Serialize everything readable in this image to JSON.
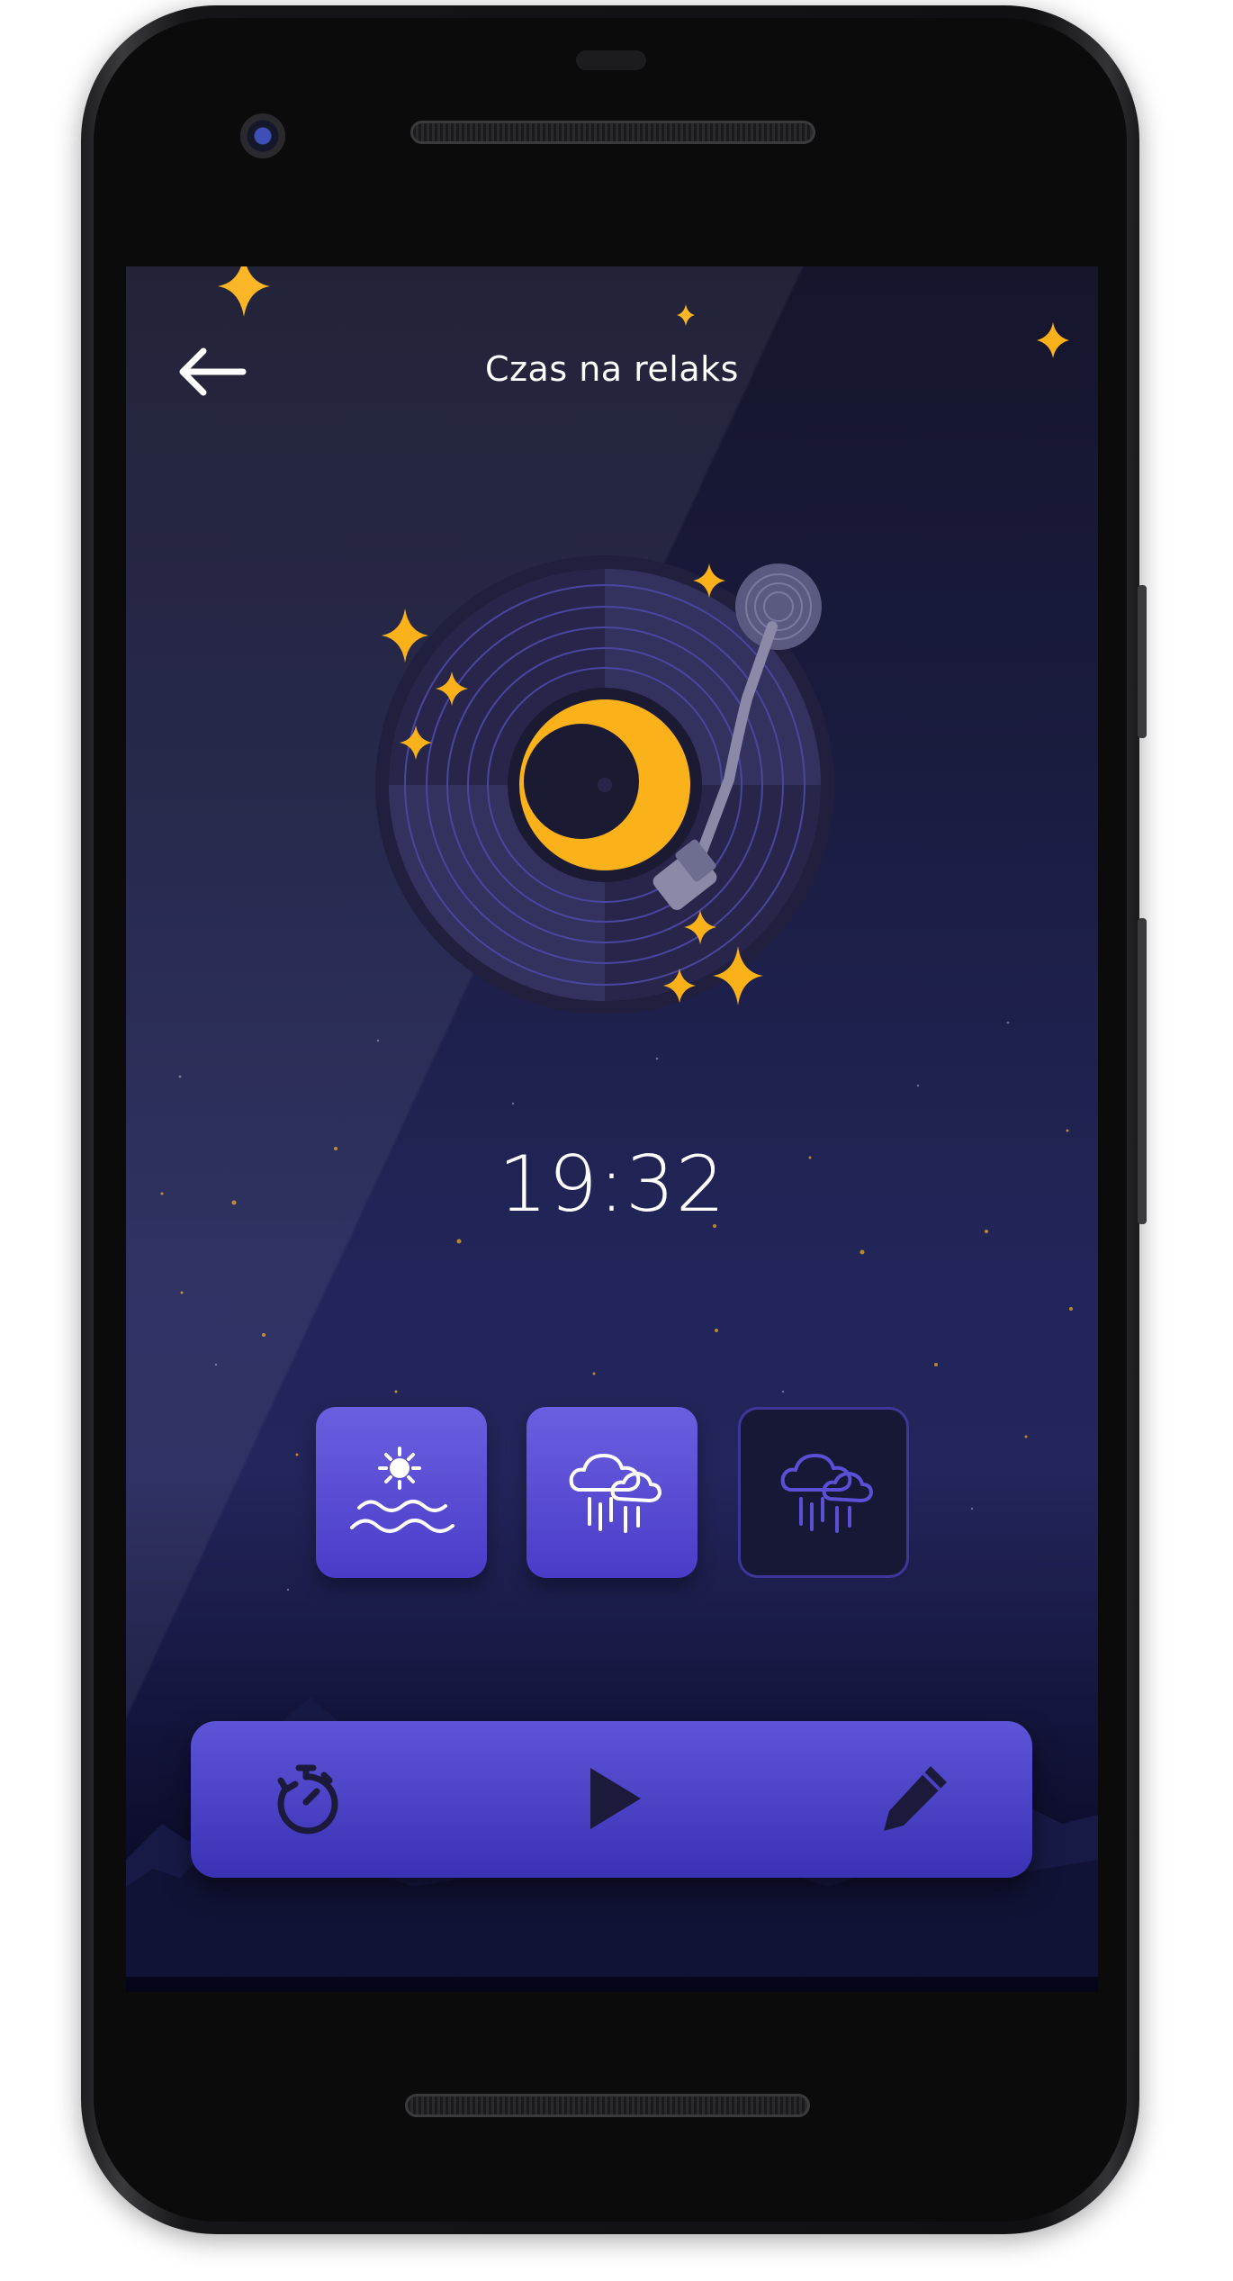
{
  "screen": {
    "title": "Czas na relaks",
    "clock": "19:32"
  },
  "icons": {
    "back": "arrow-left-icon",
    "hero": "vinyl-record-moon-illustration",
    "sound_1": "sun-over-waves-icon",
    "sound_2": "rain-cloud-icon",
    "sound_3": "rain-cloud-icon",
    "timer": "stopwatch-icon",
    "play": "play-icon",
    "edit": "pencil-icon"
  },
  "sounds": [
    {
      "name": "sun-over-waves",
      "active": true
    },
    {
      "name": "rain",
      "active": true
    },
    {
      "name": "rain",
      "active": false
    }
  ],
  "colors": {
    "accent": "#5d54d8",
    "star": "#fbb21a",
    "background_top": "#15152c",
    "background_bottom": "#05051a"
  }
}
